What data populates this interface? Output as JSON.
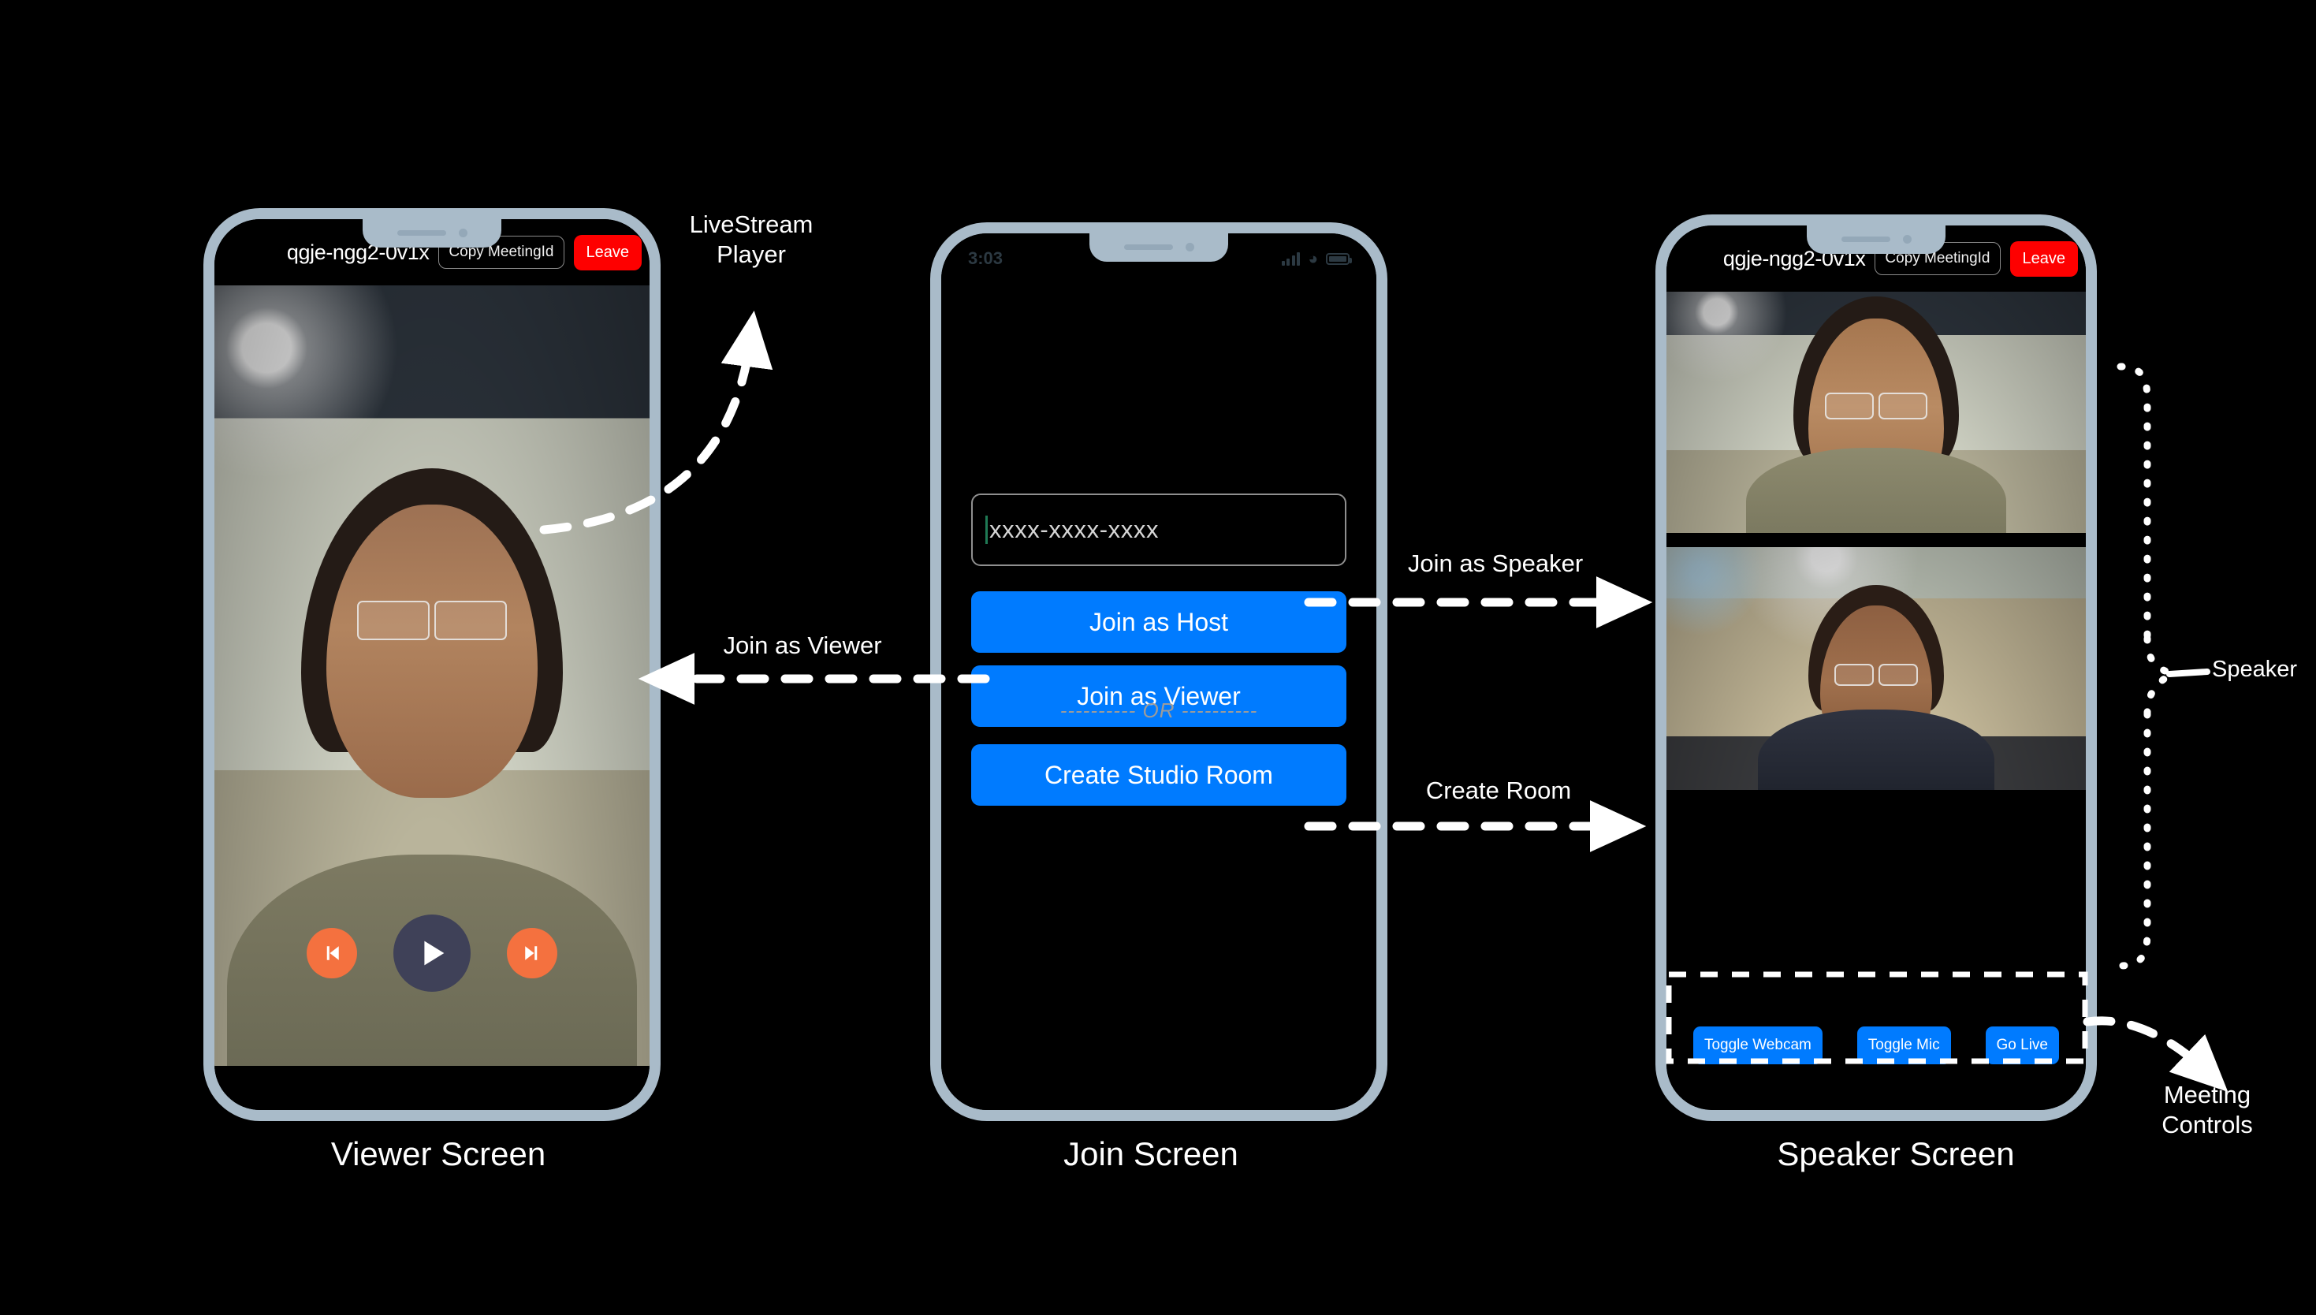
{
  "background_color": "#000000",
  "frame_color": "#a9bbc9",
  "accent_blue": "#007bff",
  "leave_red": "#fe0000",
  "skip_orange": "#f4713f",
  "play_navy": "#3f4158",
  "viewer_screen": {
    "caption": "Viewer Screen",
    "header": {
      "meeting_id": "qgje-ngg2-0v1x",
      "copy_label": "Copy MeetingId",
      "leave_label": "Leave"
    },
    "player": {
      "prev_icon": "skip-previous-icon",
      "play_icon": "play-icon",
      "next_icon": "skip-next-icon"
    }
  },
  "join_screen": {
    "caption": "Join Screen",
    "status_bar": {
      "time": "3:03",
      "signal_icon": "signal-bars-icon",
      "wifi_icon": "wifi-icon",
      "battery_icon": "battery-icon"
    },
    "meeting_input": {
      "value": "",
      "placeholder": "xxxx-xxxx-xxxx"
    },
    "buttons": [
      {
        "label": "Join as Host",
        "name": "join-as-host-button"
      },
      {
        "label": "Join as Viewer",
        "name": "join-as-viewer-button"
      },
      {
        "label": "Create Studio Room",
        "name": "create-studio-room-button"
      }
    ],
    "divider_label": "---------- OR ----------"
  },
  "speaker_screen": {
    "caption": "Speaker Screen",
    "header": {
      "meeting_id": "qgje-ngg2-0v1x",
      "copy_label": "Copy MeetingId",
      "leave_label": "Leave"
    },
    "controls": [
      {
        "label": "Toggle Webcam",
        "name": "toggle-webcam-button"
      },
      {
        "label": "Toggle Mic",
        "name": "toggle-mic-button"
      },
      {
        "label": "Go Live",
        "name": "go-live-button"
      }
    ]
  },
  "annotations": {
    "livestream_player": "LiveStream\nPlayer",
    "join_as_viewer": "Join as Viewer",
    "join_as_speaker": "Join as Speaker",
    "create_room": "Create Room",
    "speaker": "Speaker",
    "meeting_controls": "Meeting\nControls"
  }
}
